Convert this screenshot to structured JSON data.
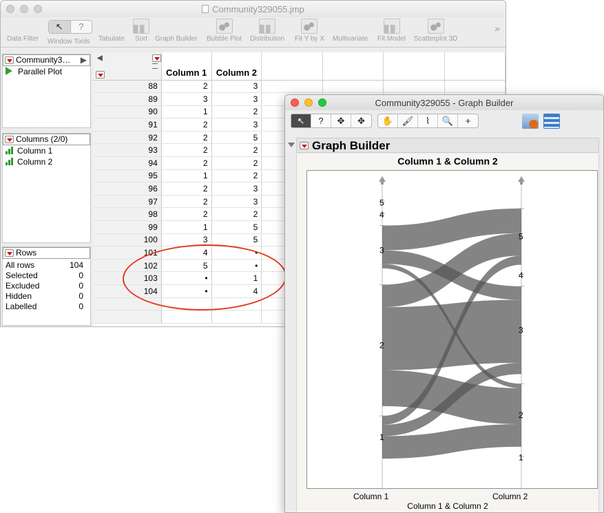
{
  "main_window": {
    "title": "Community329055.jmp",
    "toolbar": [
      "Data Filter",
      "Window Tools",
      "Tabulate",
      "Sort",
      "Graph Builder",
      "Bubble Plot",
      "Distribution",
      "Fit Y by X",
      "Multivariate",
      "Fit Model",
      "Scatterplot 3D"
    ],
    "arrow_tool": "↖",
    "help_tool": "?",
    "more": "»"
  },
  "table_panel": {
    "name": "Community3…",
    "scripts": [
      "Parallel Plot"
    ]
  },
  "columns_panel": {
    "header": "Columns (2/0)",
    "items": [
      "Column 1",
      "Column 2"
    ]
  },
  "rows_panel": {
    "header": "Rows",
    "stats": [
      {
        "label": "All rows",
        "value": "104"
      },
      {
        "label": "Selected",
        "value": "0"
      },
      {
        "label": "Excluded",
        "value": "0"
      },
      {
        "label": "Hidden",
        "value": "0"
      },
      {
        "label": "Labelled",
        "value": "0"
      }
    ]
  },
  "grid": {
    "headers": [
      "Column 1",
      "Column 2"
    ],
    "rows": [
      [
        "88",
        "2",
        "3"
      ],
      [
        "89",
        "3",
        "3"
      ],
      [
        "90",
        "1",
        "2"
      ],
      [
        "91",
        "2",
        "3"
      ],
      [
        "92",
        "2",
        "5"
      ],
      [
        "93",
        "2",
        "2"
      ],
      [
        "94",
        "2",
        "2"
      ],
      [
        "95",
        "1",
        "2"
      ],
      [
        "96",
        "2",
        "3"
      ],
      [
        "97",
        "2",
        "3"
      ],
      [
        "98",
        "2",
        "2"
      ],
      [
        "99",
        "1",
        "5"
      ],
      [
        "100",
        "3",
        "5"
      ],
      [
        "101",
        "4",
        "•"
      ],
      [
        "102",
        "5",
        "•"
      ],
      [
        "103",
        "•",
        "1"
      ],
      [
        "104",
        "•",
        "4"
      ]
    ]
  },
  "graph_window": {
    "title": "Community329055 - Graph Builder",
    "tools": [
      "↖",
      "?",
      "✥",
      "✥",
      "✋",
      "🖌",
      "⌇",
      "🔍",
      "+"
    ],
    "section_title": "Graph Builder",
    "plot_title": "Column 1 & Column 2",
    "x_ticks": [
      "Column 1",
      "Column 2"
    ],
    "x_label": "Column 1 & Column 2"
  },
  "colors": {
    "accent_red": "#e23a1c",
    "ribbon": "#555555"
  },
  "chart_data": {
    "type": "parallel-sets",
    "title": "Column 1 & Column 2",
    "xlabel": "Column 1 & Column 2",
    "axes": [
      "Column 1",
      "Column 2"
    ],
    "column1_levels": [
      {
        "level": "1",
        "count": 19
      },
      {
        "level": "2",
        "count": 54
      },
      {
        "level": "3",
        "count": 22
      },
      {
        "level": "4",
        "count": 1
      },
      {
        "level": "5",
        "count": 1
      }
    ],
    "column2_levels": [
      {
        "level": "1",
        "count": 1
      },
      {
        "level": "2",
        "count": 28
      },
      {
        "level": "3",
        "count": 39
      },
      {
        "level": "4",
        "count": 1
      },
      {
        "level": "5",
        "count": 25
      }
    ],
    "flows": [
      {
        "from": "1",
        "to": "2",
        "count": 10
      },
      {
        "from": "1",
        "to": "3",
        "count": 5
      },
      {
        "from": "1",
        "to": "5",
        "count": 4
      },
      {
        "from": "2",
        "to": "2",
        "count": 16
      },
      {
        "from": "2",
        "to": "3",
        "count": 28
      },
      {
        "from": "2",
        "to": "5",
        "count": 10
      },
      {
        "from": "3",
        "to": "2",
        "count": 2
      },
      {
        "from": "3",
        "to": "3",
        "count": 6
      },
      {
        "from": "3",
        "to": "5",
        "count": 11
      }
    ]
  }
}
